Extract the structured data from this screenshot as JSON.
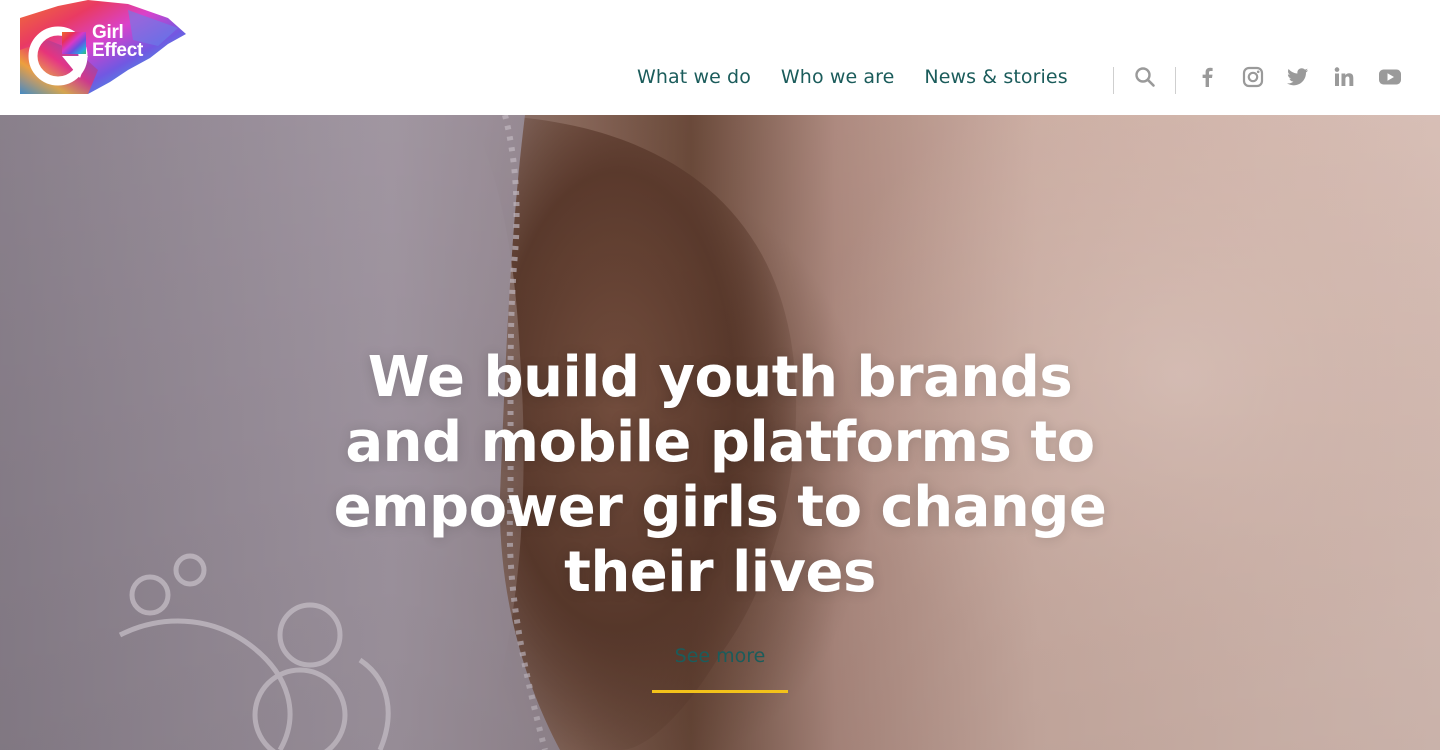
{
  "brand": {
    "logo_line1": "Girl",
    "logo_line2": "Effect"
  },
  "nav": {
    "items": [
      {
        "label": "What we do"
      },
      {
        "label": "Who we are"
      },
      {
        "label": "News & stories"
      }
    ]
  },
  "social": {
    "icons": [
      "search-icon",
      "facebook-icon",
      "instagram-icon",
      "twitter-icon",
      "linkedin-icon",
      "youtube-icon"
    ],
    "icon_color": "#9a9a9a"
  },
  "hero": {
    "headline_line1": "We build youth brands",
    "headline_line2": "and mobile platforms to",
    "headline_line3": "empower girls to change",
    "headline_line4": "their lives",
    "cta_label": "See more"
  },
  "colors": {
    "nav_text": "#1b5c5b",
    "cta_underline": "#f3c21a",
    "headline_text": "#ffffff"
  }
}
